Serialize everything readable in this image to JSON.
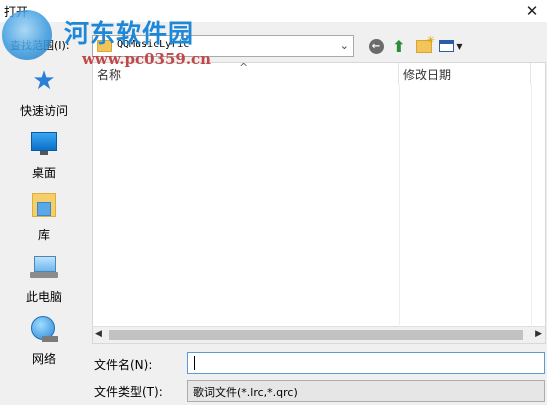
{
  "window": {
    "title": "打开",
    "close_glyph": "✕"
  },
  "watermark": {
    "brand": "河东软件园",
    "url": "www.pc0359.cn"
  },
  "toolbar": {
    "look_in_label": "查找范围(I):",
    "look_in_value": "QQMusicLyric",
    "icons": [
      "back-icon",
      "up-folder-icon",
      "new-folder-icon",
      "view-menu-icon"
    ]
  },
  "sidebar": {
    "items": [
      {
        "label": "快速访问",
        "icon": "star-icon"
      },
      {
        "label": "桌面",
        "icon": "desktop-icon"
      },
      {
        "label": "库",
        "icon": "library-icon"
      },
      {
        "label": "此电脑",
        "icon": "computer-icon"
      },
      {
        "label": "网络",
        "icon": "network-icon"
      }
    ]
  },
  "file_list": {
    "columns": [
      "名称",
      "修改日期"
    ],
    "sort_indicator": "^",
    "rows": []
  },
  "form": {
    "filename_label": "文件名(N):",
    "filename_value": "",
    "filetype_label": "文件类型(T):",
    "filetype_value": "歌词文件(*.lrc,*.qrc)"
  }
}
